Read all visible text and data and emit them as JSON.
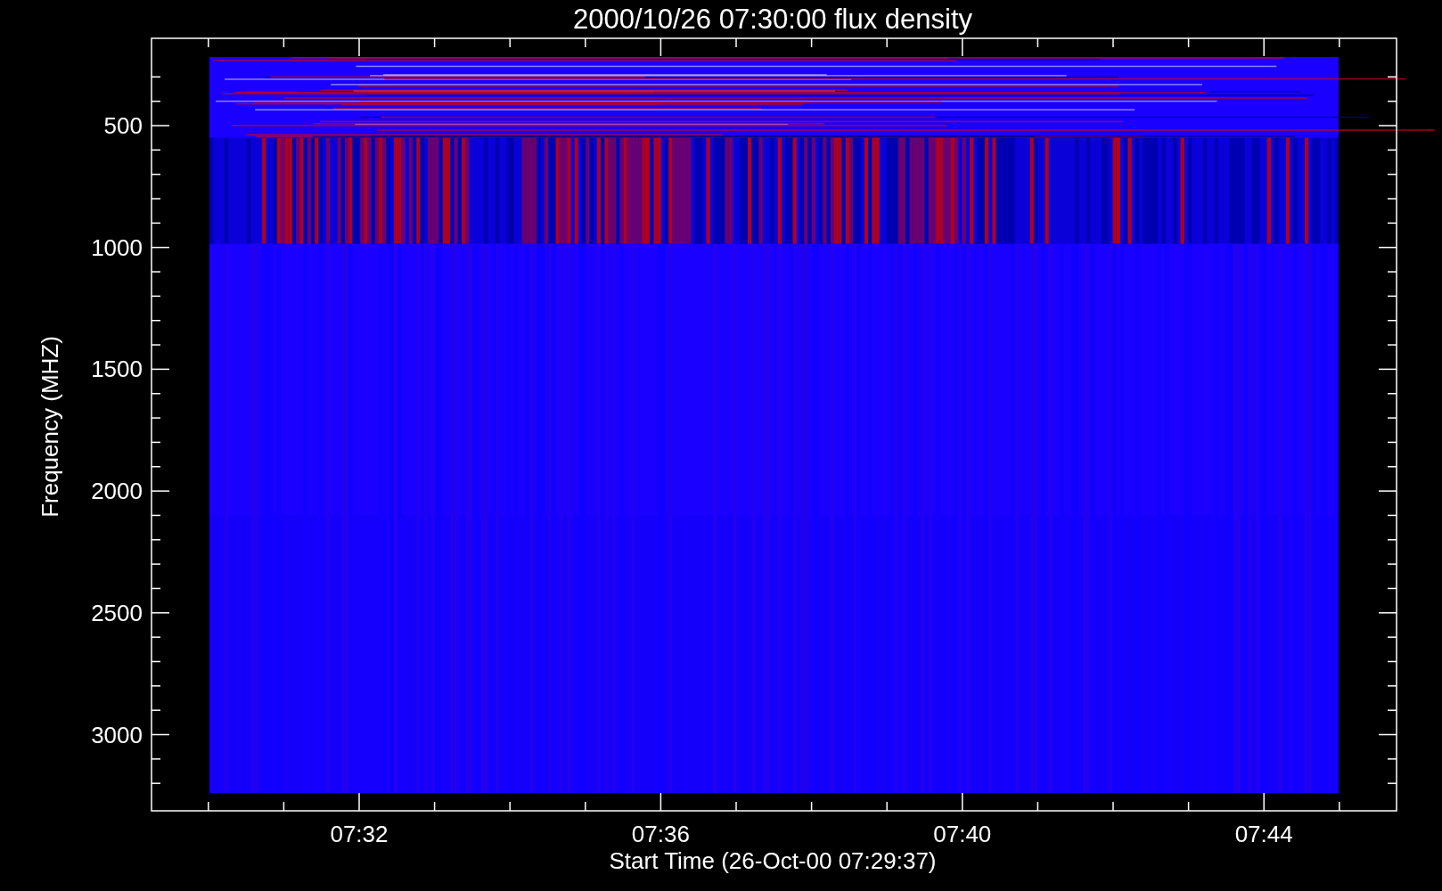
{
  "plot": {
    "title": "2000/10/26 07:30:00 flux density",
    "x_axis": {
      "label": "Start Time (26-Oct-00 07:29:37)",
      "ticks": [
        "07:32",
        "07:36",
        "07:40",
        "07:44"
      ]
    },
    "y_axis": {
      "label": "Frequency (MHZ)",
      "ticks": [
        "500",
        "1000",
        "1500",
        "2000",
        "2500",
        "3000"
      ]
    }
  }
}
